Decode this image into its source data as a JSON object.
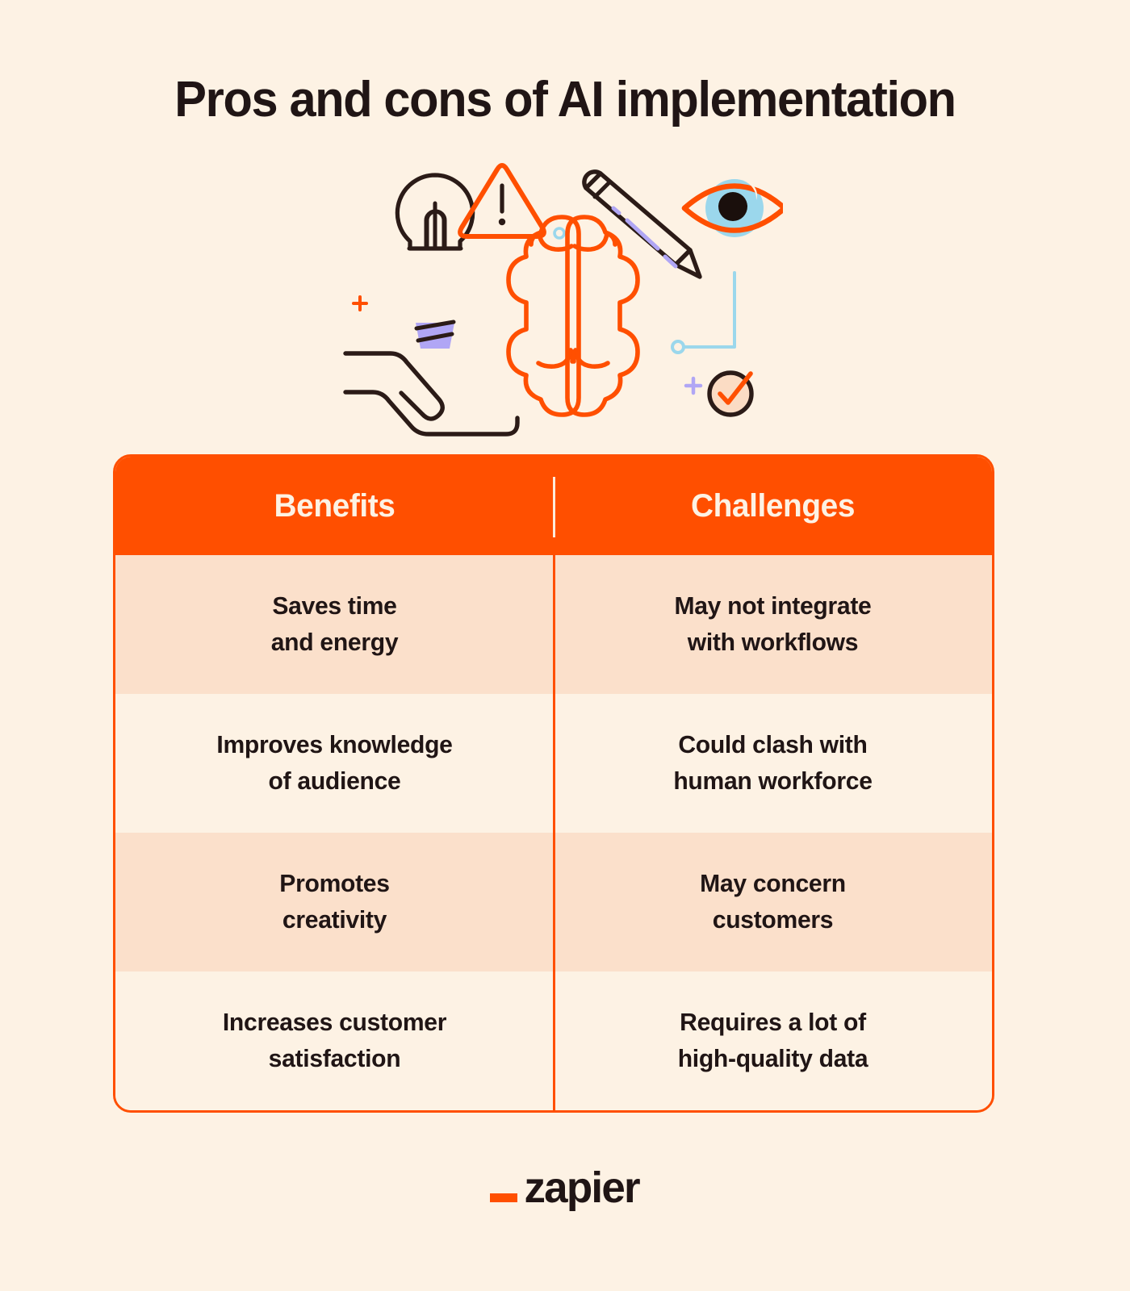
{
  "page": {
    "title": "Pros and cons of AI implementation",
    "background_color": "#FDF2E4",
    "accent_color": "#FF4F00",
    "text_color": "#201515"
  },
  "illustration": {
    "name": "ai-brain-illustration",
    "elements": [
      "lightbulb-icon",
      "hand-icon",
      "warning-triangle-icon",
      "brain-icon",
      "pencil-icon",
      "eye-icon",
      "checkmark-circle-icon",
      "plus-orange-decoration",
      "plus-purple-decoration",
      "circle-blue-decoration",
      "connector-line-blue"
    ],
    "colors": {
      "orange": "#FF4F00",
      "dark": "#2B1B17",
      "purple": "#B0A6F5",
      "blue": "#9BD7EC",
      "peach": "#FBDCC4"
    }
  },
  "table": {
    "columns": [
      {
        "label": "Benefits",
        "name": "benefits"
      },
      {
        "label": "Challenges",
        "name": "challenges"
      }
    ],
    "rows": [
      {
        "benefit": "Saves time\nand energy",
        "challenge": "May not integrate\nwith workflows",
        "shade": "a"
      },
      {
        "benefit": "Improves knowledge\nof audience",
        "challenge": "Could clash with\nhuman workforce",
        "shade": "b"
      },
      {
        "benefit": "Promotes\ncreativity",
        "challenge": "May concern\ncustomers",
        "shade": "a"
      },
      {
        "benefit": "Increases customer\nsatisfaction",
        "challenge": "Requires a lot of\nhigh-quality data",
        "shade": "b"
      }
    ]
  },
  "footer": {
    "brand": "zapier",
    "brand_mark": "_"
  }
}
